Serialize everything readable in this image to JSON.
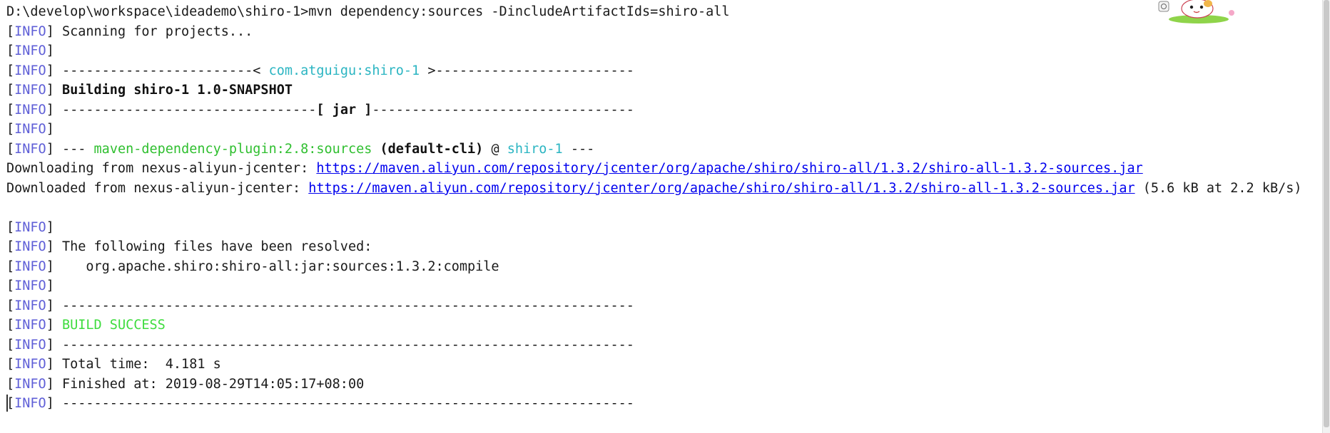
{
  "terminal": {
    "prompt": "D:\\develop\\workspace\\ideademo\\shiro-1>",
    "command": "mvn dependency:sources -DincludeArtifactIds=shiro-all",
    "info_open": "[",
    "info_word": "INFO",
    "info_close": "]",
    "scanning": "Scanning for projects...",
    "project_dashes_left": "------------------------< ",
    "project_coord": "com.atguigu:shiro-1",
    "project_dashes_right": " >-------------------------",
    "building": "Building shiro-1 1.0-SNAPSHOT",
    "jar_dashes_left": "--------------------------------",
    "jar_label": "[ jar ]",
    "jar_dashes_right": "---------------------------------",
    "plugin_dashes": "--- ",
    "plugin": "maven-dependency-plugin:2.8:sources",
    "execution": " (default-cli)",
    "at": " @ ",
    "plugin_project": "shiro-1",
    "plugin_dashes_end": " ---",
    "downloading_prefix": "Downloading from nexus-aliyun-jcenter: ",
    "downloading_url": "https://maven.aliyun.com/repository/jcenter/org/apache/shiro/shiro-all/1.3.2/shiro-all-1.3.2-sources.jar",
    "downloaded_prefix": "Downloaded from nexus-aliyun-jcenter: ",
    "downloaded_url": "https://maven.aliyun.com/repository/jcenter/org/apache/shiro/shiro-all/1.3.2/shiro-all-1.3.2-sources.jar",
    "downloaded_suffix": " (5.6 kB at 2.2 kB/s)",
    "resolved_header": "The following files have been resolved:",
    "resolved_item": "   org.apache.shiro:shiro-all:jar:sources:1.3.2:compile",
    "separator": "------------------------------------------------------------------------",
    "build_success": "BUILD SUCCESS",
    "total_time": "Total time:  4.181 s",
    "finished_at": "Finished at: 2019-08-29T14:05:17+08:00"
  },
  "colors": {
    "info": "#5f5fd7",
    "cyan": "#2bb5c2",
    "green": "#2fbf2f",
    "success": "#3ddc3d",
    "link": "#0000ee"
  }
}
